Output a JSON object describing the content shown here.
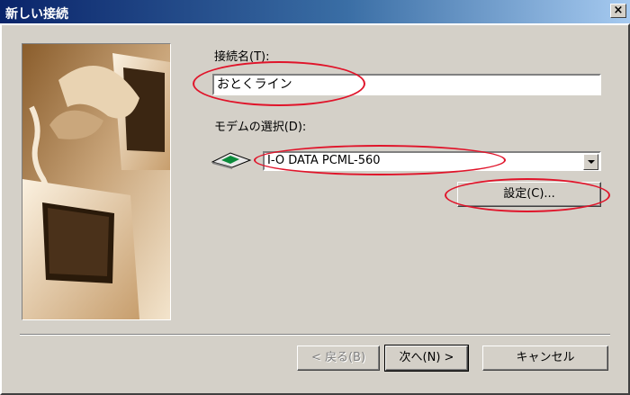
{
  "window": {
    "title": "新しい接続",
    "close_label": "×"
  },
  "connection_name": {
    "label": "接続名(T):",
    "value": "おとくライン"
  },
  "modem": {
    "label": "モデムの選択(D):",
    "selected": "I-O DATA PCML-560",
    "icon": "modem-card-icon"
  },
  "settings_button": "設定(C)...",
  "footer": {
    "back": "< 戻る(B)",
    "next": "次へ(N) >",
    "cancel": "キャンセル"
  },
  "colors": {
    "highlight_oval": "#e0142a",
    "title_start": "#0a246a",
    "face": "#d4d0c8"
  }
}
